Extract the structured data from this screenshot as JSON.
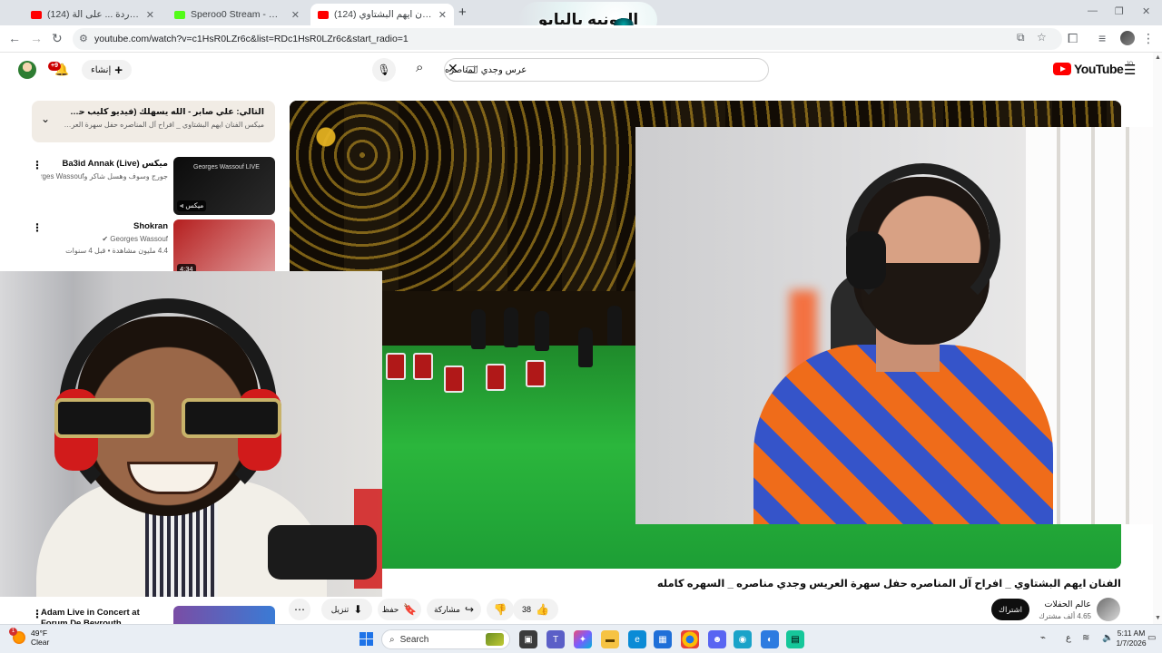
{
  "browser": {
    "tabs": [
      {
        "title": "(124) محوز وردة ... على الة",
        "favicon_color": "#ff0000",
        "active": false
      },
      {
        "title": "Speroo0 Stream - Watch Live o",
        "favicon_color": "#53fc18",
        "active": false
      },
      {
        "title": "(124) الفنان ايهم البشتاوي _",
        "favicon_color": "#ff0000",
        "active": true
      }
    ],
    "new_tab": "+",
    "address": "youtube.com/watch?v=c1HsR0LZr6c&list=RDc1HsR0LZr6c&start_radio=1",
    "overlay_logo_text": "الدونيه بالبابو"
  },
  "youtube": {
    "logo_text": "YouTube",
    "logo_sup": "JO",
    "search_query": "عرس وجدي المناصره",
    "create_label": "إنشاء",
    "notifications_badge": "+9"
  },
  "queue": {
    "next_title": "التالي: علي صابر - الله يسهلك (فيديو كليب حصري) | 2019 | (Clip ...",
    "next_sub": "ميكس الفنان ايهم البشتاوي _ افراح آل المناصره حفل سهرة العريس وجدي مناصره ..."
  },
  "recommendations": [
    {
      "title": "ميكس Ba3id Annak (Live)",
      "sub": "جورج وسوف وهسل شاكر وGeorges Wassouf و...",
      "badge": "ميكس",
      "thumb_text": "Georges Wassouf LIVE"
    },
    {
      "title": "Shokran",
      "sub": "Georges Wassouf",
      "sub2": "4.4 مليون مشاهدة • قبل 4 سنوات",
      "badge": "4:34"
    }
  ],
  "bottom_rec": {
    "title": "Adam Live in Concert at Forum De Beyrouth"
  },
  "video": {
    "title": "الفنان ايهم البشتاوي _ افراح آل المناصره حفل سهرة العريس وجدي مناصره _ السهره كامله",
    "channel": "عالم الحفلات",
    "subscribers": "4.65 ألف مشترك",
    "subscribe_label": "اشتراك",
    "likes": "38",
    "share_label": "مشاركة",
    "save_label": "حفظ",
    "download_label": "تنزيل"
  },
  "taskbar": {
    "weather_temp": "49°F",
    "weather_desc": "Clear",
    "weather_badge": "1",
    "search_label": "Search",
    "lang": "ع",
    "time": "5:11 AM",
    "date": "1/7/2026"
  }
}
